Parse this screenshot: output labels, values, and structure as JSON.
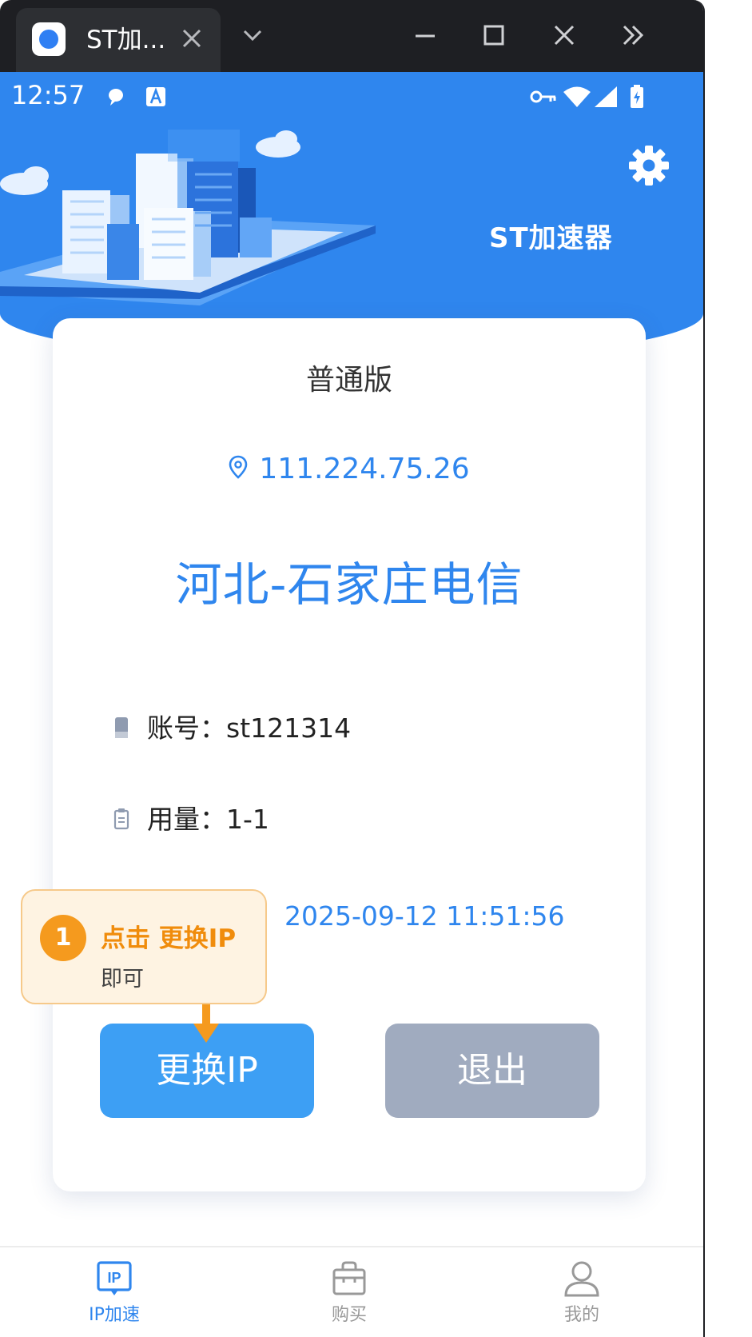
{
  "browser": {
    "tab_title": "ST加...",
    "icons": [
      "app-logo-icon",
      "close-icon",
      "chevron-down-icon",
      "minimize-icon",
      "maximize-icon",
      "close-icon",
      "double-chevron-right-icon"
    ]
  },
  "status_bar": {
    "time": "12:57",
    "icons": [
      "chat-bubble-icon",
      "font-a-icon",
      "vpn-key-icon",
      "wifi-icon",
      "signal-icon",
      "battery-icon"
    ]
  },
  "header": {
    "app_title": "ST加速器",
    "settings_icon": "gear-icon"
  },
  "card": {
    "plan": "普通版",
    "ip": "111.224.75.26",
    "region": "河北-石家庄电信",
    "account_label": "账号：",
    "account_value": "st121314",
    "usage_label": "用量：",
    "usage_value": "1-1",
    "expire_time": "2025-09-12 11:51:56",
    "change_ip_button": "更换IP",
    "exit_button": "退出"
  },
  "tip": {
    "number": "1",
    "title": "点击 更换IP",
    "subtitle": "即可"
  },
  "bottom_nav": {
    "items": [
      {
        "label": "IP加速",
        "icon": "ip-icon",
        "active": true
      },
      {
        "label": "购买",
        "icon": "shopping-bag-icon",
        "active": false
      },
      {
        "label": "我的",
        "icon": "user-icon",
        "active": false
      }
    ]
  },
  "colors": {
    "primary": "#2f86ee",
    "button_primary": "#3d9ff4",
    "button_secondary": "#a0abbf",
    "tip_accent": "#f59a1e",
    "nav_inactive": "#999999"
  }
}
